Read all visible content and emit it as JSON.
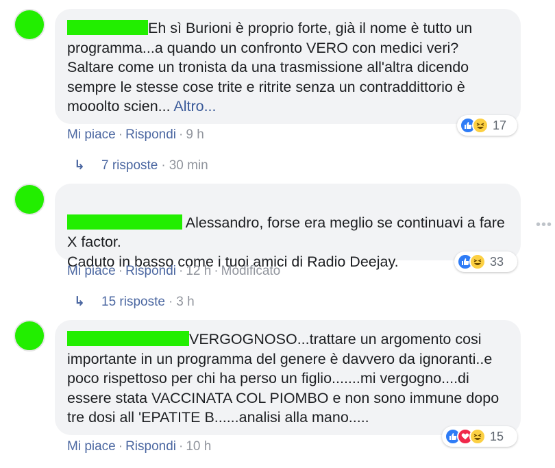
{
  "comments": [
    {
      "text": "Eh sì Burioni è proprio forte, già il nome è tutto un programma...a quando un confronto VERO con medici veri? Saltare come un tronista da una trasmissione all'altra dicendo sempre le stesse cose trite e ritrite senza un contraddittorio è mooolto scien...",
      "more_label": "Altro...",
      "like_label": "Mi piace",
      "reply_label": "Rispondi",
      "time": "9 h",
      "edited": "",
      "reaction_count": "17",
      "replies_label": "7 risposte",
      "replies_time": "30 min"
    },
    {
      "text": "Alessandro, forse era meglio se continuavi a fare X factor.\nCaduto in basso come i tuoi amici di Radio Deejay.",
      "more_label": "",
      "like_label": "Mi piace",
      "reply_label": "Rispondi",
      "time": "12 h",
      "edited": "Modificato",
      "reaction_count": "33",
      "replies_label": "15 risposte",
      "replies_time": "3 h"
    },
    {
      "text": "VERGOGNOSO...trattare un argomento cosi importante in un programma del genere è davvero da ignoranti..e poco rispettoso per chi ha perso un figlio.......mi vergogno....di essere stata VACCINATA COL PIOMBO e non sono immune dopo tre dosi all 'EPATITE B......analisi alla mano.....",
      "more_label": "",
      "like_label": "Mi piace",
      "reply_label": "Rispondi",
      "time": "10 h",
      "edited": "",
      "reaction_count": "15",
      "replies_label": "",
      "replies_time": ""
    }
  ],
  "icons": {
    "reply_arrow": "reply-arrow-icon",
    "like": "like-icon",
    "love": "love-icon",
    "haha": "haha-icon",
    "more": "more-options-icon"
  },
  "colors": {
    "link": "#4b67a1",
    "meta": "#90949c",
    "bubble": "#f2f3f5",
    "redaction": "#22ee00",
    "like": "#2e7cf6",
    "love": "#f0284a",
    "haha": "#fcd043"
  }
}
